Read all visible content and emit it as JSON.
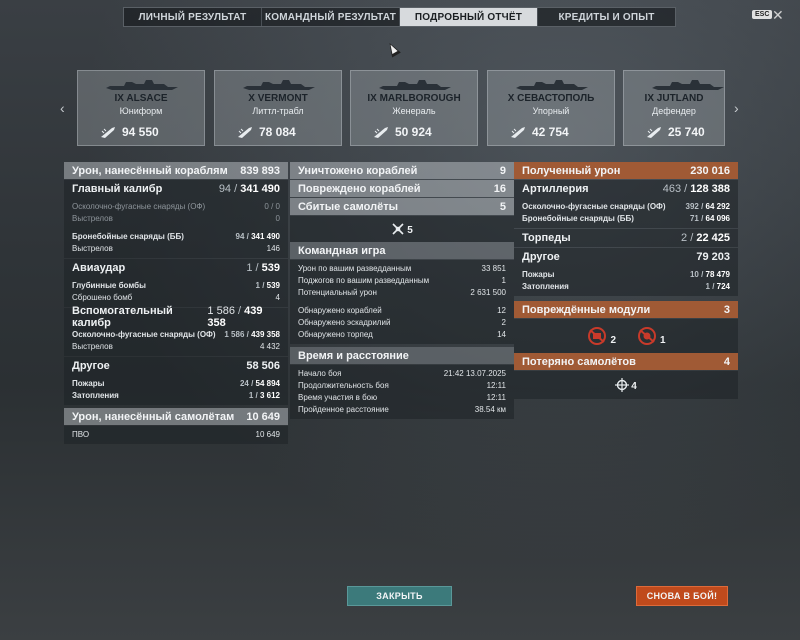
{
  "tabs": [
    "ЛИЧНЫЙ РЕЗУЛЬТАТ",
    "КОМАНДНЫЙ РЕЗУЛЬТАТ",
    "ПОДРОБНЫЙ ОТЧЁТ",
    "КРЕДИТЫ И ОПЫТ"
  ],
  "esc_label": "ESC",
  "ships": [
    {
      "tier": "IX",
      "name": "ALSACE",
      "player": "Юниформ",
      "damage": "94 550"
    },
    {
      "tier": "X",
      "name": "VERMONT",
      "player": "Литтл-трабл",
      "damage": "78 084"
    },
    {
      "tier": "IX",
      "name": "MARLBOROUGH",
      "player": "Женераль",
      "damage": "50 924"
    },
    {
      "tier": "X",
      "name": "СЕВАСТОПОЛЬ",
      "player": "Упорный",
      "damage": "42 754"
    },
    {
      "tier": "IX",
      "name": "JUTLAND",
      "player": "Дефендер",
      "damage": "25 740"
    }
  ],
  "left": {
    "ship_damage": {
      "label": "Урон, нанесённый кораблям",
      "value": "839 893"
    },
    "main_battery": {
      "label": "Главный калибр",
      "hits": "94",
      "damage": "341 490"
    },
    "he_shells": {
      "label": "Осколочно-фугасные снаряды (ОФ)",
      "value": "0 / 0"
    },
    "he_shots": {
      "label": "Выстрелов",
      "value": "0"
    },
    "ap_shells": {
      "label": "Бронебойные снаряды (ББ)",
      "hits": "94",
      "damage": "341 490"
    },
    "ap_shots": {
      "label": "Выстрелов",
      "value": "146"
    },
    "airstrike": {
      "label": "Авиаудар",
      "hits": "1",
      "damage": "539"
    },
    "depth_charges": {
      "label": "Глубинные бомбы",
      "hits": "1",
      "damage": "539"
    },
    "bombs_dropped": {
      "label": "Сброшено бомб",
      "value": "4"
    },
    "secondary": {
      "label": "Вспомогательный калибр",
      "hits": "1 586",
      "damage": "439 358"
    },
    "sec_he": {
      "label": "Осколочно-фугасные снаряды (ОФ)",
      "hits": "1 586",
      "damage": "439 358"
    },
    "sec_shots": {
      "label": "Выстрелов",
      "value": "4 432"
    },
    "other": {
      "label": "Другое",
      "value": "58 506"
    },
    "fires": {
      "label": "Пожары",
      "hits": "24",
      "damage": "54 894"
    },
    "flooding": {
      "label": "Затопления",
      "hits": "1",
      "damage": "3 612"
    },
    "plane_damage": {
      "label": "Урон, нанесённый самолётам",
      "value": "10 649"
    },
    "aa": {
      "label": "ПВО",
      "value": "10 649"
    }
  },
  "middle": {
    "destroyed": {
      "label": "Уничтожено кораблей",
      "value": "9"
    },
    "damaged": {
      "label": "Повреждено кораблей",
      "value": "16"
    },
    "planes": {
      "label": "Сбитые самолёты",
      "value": "5"
    },
    "planes_icon_count": "5",
    "teamplay": {
      "title": "Командная игра",
      "spotting_damage": {
        "label": "Урон по вашим разведданным",
        "value": "33 851"
      },
      "spotting_fires": {
        "label": "Поджогов по вашим разведданным",
        "value": "1"
      },
      "potential": {
        "label": "Потенциальный урон",
        "value": "2 631 500"
      },
      "ships_spotted": {
        "label": "Обнаружено кораблей",
        "value": "12"
      },
      "squadrons_spotted": {
        "label": "Обнаружено эскадрилий",
        "value": "2"
      },
      "torps_spotted": {
        "label": "Обнаружено торпед",
        "value": "14"
      }
    },
    "time": {
      "title": "Время и расстояние",
      "start": {
        "label": "Начало боя",
        "value": "21:42  13.07.2025"
      },
      "duration": {
        "label": "Продолжительность боя",
        "value": "12:11"
      },
      "participation": {
        "label": "Время участия в бою",
        "value": "12:11"
      },
      "distance": {
        "label": "Пройденное расстояние",
        "value": "38.54 км"
      }
    }
  },
  "right": {
    "received": {
      "label": "Полученный урон",
      "value": "230 016"
    },
    "artillery": {
      "label": "Артиллерия",
      "hits": "463",
      "damage": "128 388"
    },
    "he": {
      "label": "Осколочно-фугасные снаряды (ОФ)",
      "hits": "392",
      "damage": "64 292"
    },
    "ap": {
      "label": "Бронебойные снаряды (ББ)",
      "hits": "71",
      "damage": "64 096"
    },
    "torpedoes": {
      "label": "Торпеды",
      "hits": "2",
      "damage": "22 425"
    },
    "other": {
      "label": "Другое",
      "value": "79 203"
    },
    "fires": {
      "label": "Пожары",
      "hits": "10",
      "damage": "78 479"
    },
    "flooding": {
      "label": "Затопления",
      "hits": "1",
      "damage": "724"
    },
    "modules": {
      "label": "Повреждённые модули",
      "value": "3",
      "icon1_count": "2",
      "icon2_count": "1"
    },
    "planes_lost": {
      "label": "Потеряно самолётов",
      "value": "4",
      "icon_count": "4"
    }
  },
  "buttons": {
    "close": "ЗАКРЫТЬ",
    "battle": "СНОВА В БОЙ!"
  },
  "colors": {
    "accent_orange": "#a05a35",
    "close_button": "#3c7a7b",
    "battle_button": "#c04a1c"
  }
}
